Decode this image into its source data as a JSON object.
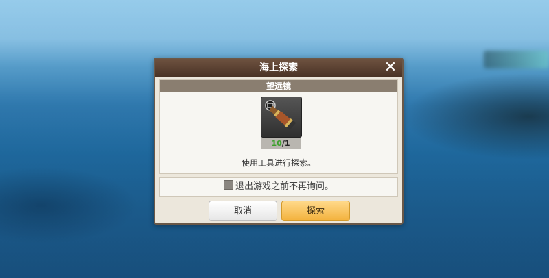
{
  "dialog": {
    "title": "海上探索",
    "item_name": "望远镜",
    "count_current": "10",
    "count_separator": "/",
    "count_required": "1",
    "description": "使用工具进行探索。",
    "checkbox_label": "退出游戏之前不再询问。",
    "checkbox_checked": false,
    "cancel_label": "取消",
    "confirm_label": "探索"
  },
  "icons": {
    "close": "close-icon",
    "item": "telescope-icon",
    "checkbox": "checkbox-icon"
  }
}
